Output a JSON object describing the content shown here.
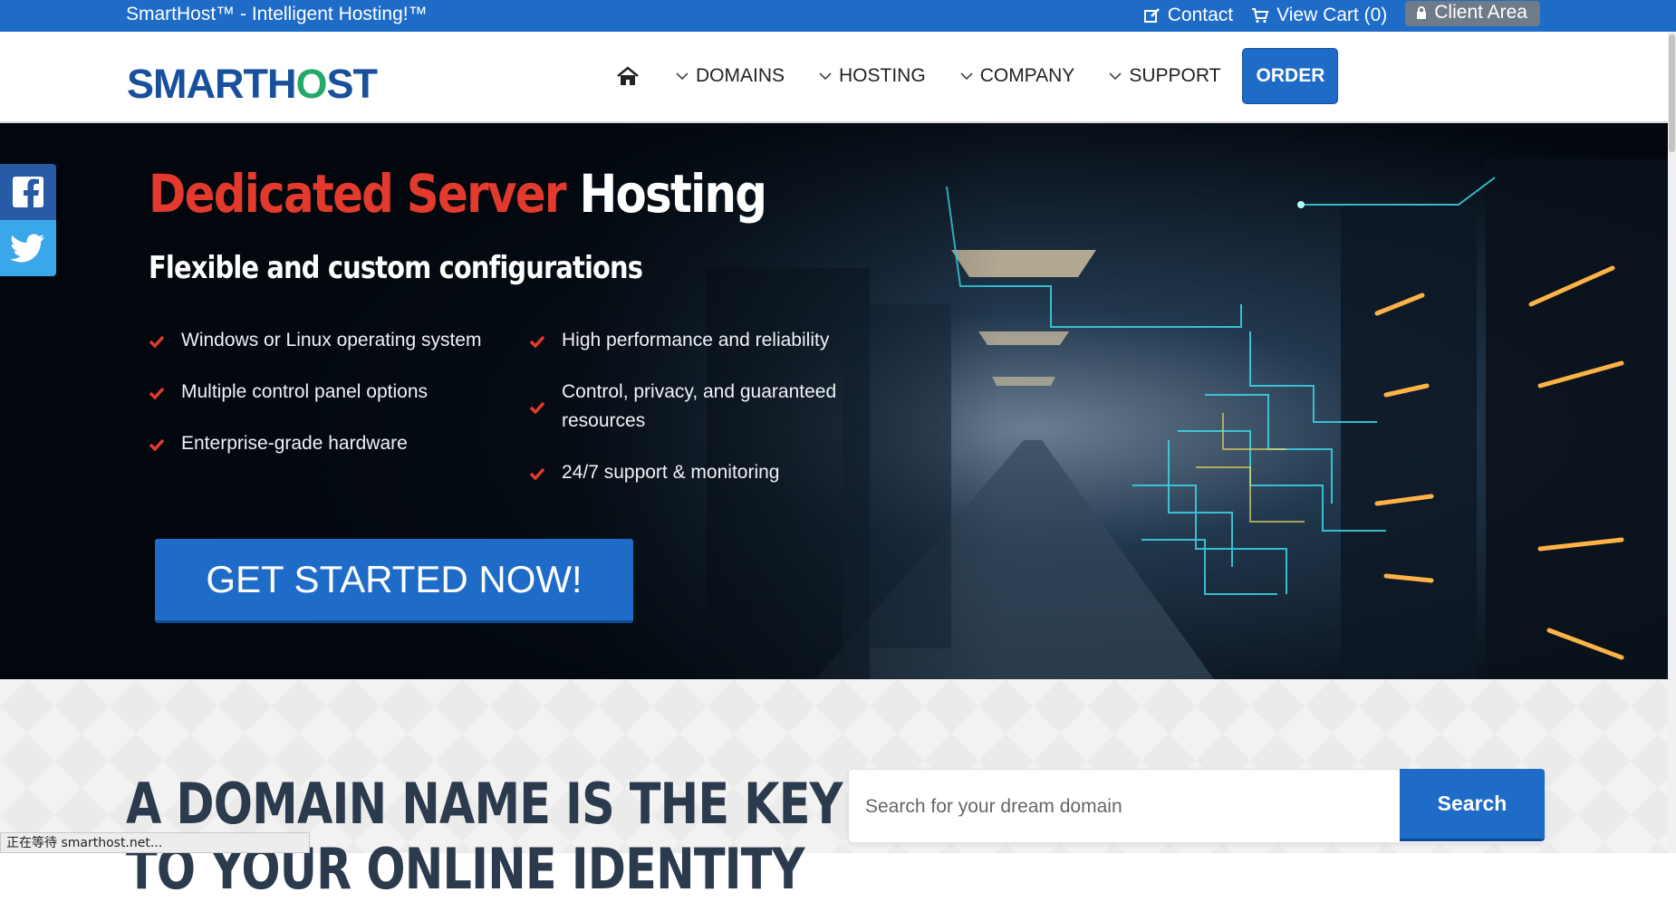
{
  "topbar": {
    "tagline": "SmartHost™ - Intelligent Hosting!™",
    "contact": "Contact",
    "cart": "View Cart (0)",
    "client_area": "Client Area"
  },
  "header": {
    "logo_text_1": "SMARTH",
    "logo_text_2": "O",
    "logo_text_3": "ST",
    "nav": [
      "DOMAINS",
      "HOSTING",
      "COMPANY",
      "SUPPORT"
    ],
    "order": "ORDER"
  },
  "hero": {
    "title_red": "Dedicated Server",
    "title_white": "Hosting",
    "subtitle": "Flexible and custom configurations",
    "features_left": [
      "Windows or Linux operating system",
      "Multiple control panel options",
      "Enterprise-grade hardware"
    ],
    "features_right": [
      "High performance and reliability",
      "Control, privacy, and guaranteed resources",
      "24/7 support & monitoring"
    ],
    "cta": "GET STARTED NOW!"
  },
  "domain": {
    "heading_line1": "A DOMAIN NAME IS THE KEY",
    "heading_line2": "TO YOUR ONLINE IDENTITY",
    "search_placeholder": "Search for your dream domain",
    "search_button": "Search"
  },
  "status_bar": "正在等待 smarthost.net...",
  "colors": {
    "brand_blue": "#1f6bc8",
    "accent_red": "#e33a2d",
    "facebook": "#285aa5",
    "twitter": "#3aa7ea"
  }
}
